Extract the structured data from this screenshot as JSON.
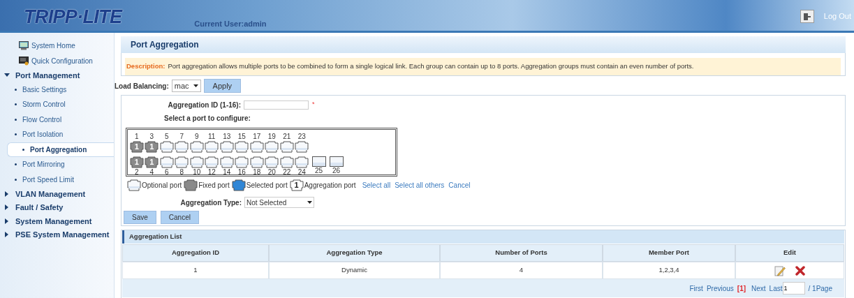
{
  "header": {
    "logo": "TRIPP·LITE",
    "current_user": "Current User:admin",
    "logout": "Log Out"
  },
  "sidebar": {
    "items": [
      {
        "kind": "link",
        "label": "System Home"
      },
      {
        "kind": "link",
        "label": "Quick Configuration"
      },
      {
        "kind": "group",
        "label": "Port Management",
        "expanded": true,
        "children": [
          {
            "label": "Basic Settings",
            "selected": false
          },
          {
            "label": "Storm Control",
            "selected": false
          },
          {
            "label": "Flow Control",
            "selected": false
          },
          {
            "label": "Port Isolation",
            "selected": false
          },
          {
            "label": "Port Aggregation",
            "selected": true
          },
          {
            "label": "Port Mirroring",
            "selected": false
          },
          {
            "label": "Port Speed Limit",
            "selected": false
          }
        ]
      },
      {
        "kind": "group",
        "label": "VLAN Management",
        "expanded": false
      },
      {
        "kind": "group",
        "label": "Fault / Safety",
        "expanded": false
      },
      {
        "kind": "group",
        "label": "System Management",
        "expanded": false
      },
      {
        "kind": "group",
        "label": "PSE System Management",
        "expanded": false
      }
    ]
  },
  "page": {
    "title": "Port Aggregation",
    "description": {
      "label": "Description:",
      "text": "Port aggregation allows multiple ports to be combined to form a single logical link. Each group can contain up to 8 ports. Aggregation groups must contain an even number of ports."
    },
    "load_balancing": {
      "label": "Load Balancing:",
      "value": "mac",
      "button": "Apply"
    },
    "aggregation_id": {
      "label": "Aggregation ID (1-16):",
      "required": "*"
    },
    "select_label": "Select a port to configure:",
    "ports_top": [
      {
        "label": "1",
        "kind": "fixed",
        "group": "1"
      },
      {
        "label": "3",
        "kind": "fixed",
        "group": "1"
      },
      {
        "label": "5",
        "kind": "optional"
      },
      {
        "label": "7",
        "kind": "optional"
      },
      {
        "label": "9",
        "kind": "optional"
      },
      {
        "label": "11",
        "kind": "optional"
      },
      {
        "label": "13",
        "kind": "optional"
      },
      {
        "label": "15",
        "kind": "optional"
      },
      {
        "label": "17",
        "kind": "optional"
      },
      {
        "label": "19",
        "kind": "optional"
      },
      {
        "label": "21",
        "kind": "optional"
      },
      {
        "label": "23",
        "kind": "optional"
      }
    ],
    "ports_bottom": [
      {
        "label": "2",
        "kind": "fixed",
        "group": "1"
      },
      {
        "label": "4",
        "kind": "fixed",
        "group": "1"
      },
      {
        "label": "6",
        "kind": "optional"
      },
      {
        "label": "8",
        "kind": "optional"
      },
      {
        "label": "10",
        "kind": "optional"
      },
      {
        "label": "12",
        "kind": "optional"
      },
      {
        "label": "14",
        "kind": "optional"
      },
      {
        "label": "16",
        "kind": "optional"
      },
      {
        "label": "18",
        "kind": "optional"
      },
      {
        "label": "20",
        "kind": "optional"
      },
      {
        "label": "22",
        "kind": "optional"
      },
      {
        "label": "24",
        "kind": "optional"
      },
      {
        "label": "25",
        "kind": "sfp"
      },
      {
        "label": "26",
        "kind": "sfp"
      }
    ],
    "legend": [
      {
        "kind": "optional",
        "label": "Optional port"
      },
      {
        "kind": "fixed",
        "label": "Fixed port"
      },
      {
        "kind": "selected",
        "label": "Selected port"
      },
      {
        "kind": "aggregation",
        "group": "1",
        "label": "Aggregation port"
      }
    ],
    "port_links": [
      "Select all",
      "Select all others",
      "Cancel"
    ],
    "aggregation_type": {
      "label": "Aggregation Type:",
      "value": "Not Selected"
    },
    "buttons": [
      "Save",
      "Cancel"
    ],
    "list": {
      "title": "Aggregation List",
      "columns": [
        "Aggregation ID",
        "Aggregation Type",
        "Number of Ports",
        "Member Port",
        "Edit"
      ],
      "rows": [
        {
          "cells": [
            "1",
            "Dynamic",
            "4",
            "1,2,3,4"
          ]
        }
      ],
      "pager": {
        "first": "First",
        "previous": "Previous",
        "current": "[1]",
        "next": "Next",
        "last": "Last",
        "page_value": "1",
        "total": "/ 1Page"
      }
    }
  }
}
